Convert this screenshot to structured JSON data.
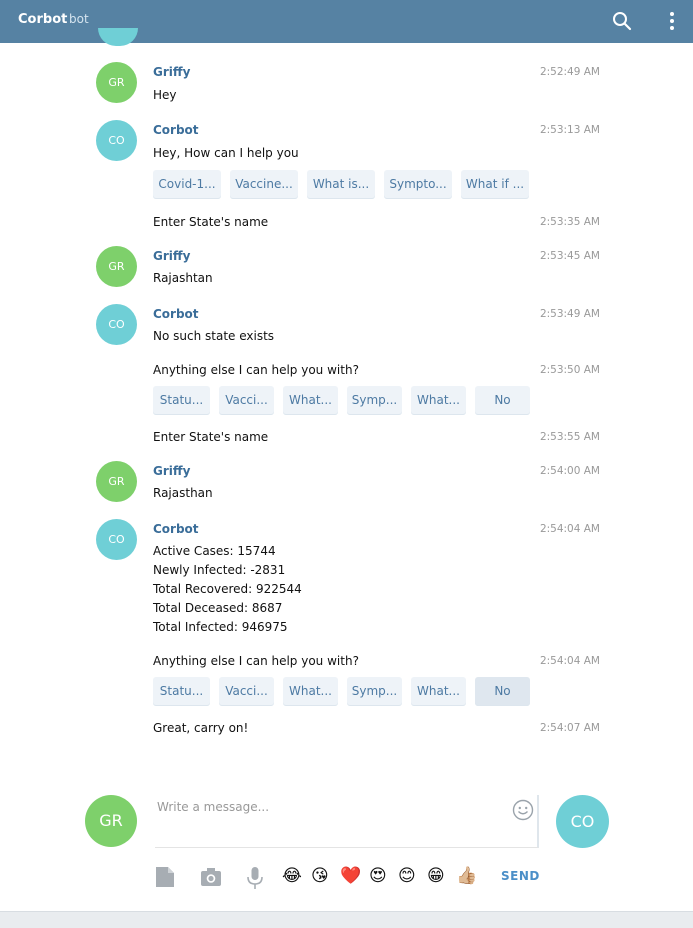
{
  "header": {
    "title": "Corbot",
    "subtitle": "bot"
  },
  "messages": {
    "m1": {
      "avatar": "GR",
      "name": "Griffy",
      "time": "2:52:49 AM",
      "text": "Hey"
    },
    "m2": {
      "avatar": "CO",
      "name": "Corbot",
      "time": "2:53:13 AM",
      "text": "Hey, How can I help you",
      "buttons": [
        "Covid-1...",
        "Vaccine...",
        "What is...",
        "Sympto...",
        "What if ..."
      ]
    },
    "m3": {
      "time": "2:53:35 AM",
      "text": "Enter State's name"
    },
    "m4": {
      "avatar": "GR",
      "name": "Griffy",
      "time": "2:53:45 AM",
      "text": "Rajashtan"
    },
    "m5": {
      "avatar": "CO",
      "name": "Corbot",
      "time": "2:53:49 AM",
      "text": "No such state exists"
    },
    "m6": {
      "time": "2:53:50 AM",
      "text": "Anything else I can help you with?",
      "buttons": [
        "Statu...",
        "Vacci...",
        "What...",
        "Symp...",
        "What...",
        "No"
      ]
    },
    "m7": {
      "time": "2:53:55 AM",
      "text": "Enter State's name"
    },
    "m8": {
      "avatar": "GR",
      "name": "Griffy",
      "time": "2:54:00 AM",
      "text": "Rajasthan"
    },
    "m9": {
      "avatar": "CO",
      "name": "Corbot",
      "time": "2:54:04 AM",
      "lines": [
        "Active Cases: 15744",
        "Newly Infected: -2831",
        "Total Recovered: 922544",
        "Total Deceased: 8687",
        "Total Infected: 946975"
      ]
    },
    "m10": {
      "time": "2:54:04 AM",
      "text": "Anything else I can help you with?",
      "buttons": [
        "Statu...",
        "Vacci...",
        "What...",
        "Symp...",
        "What...",
        "No"
      ]
    },
    "m11": {
      "time": "2:54:07 AM",
      "text": "Great, carry on!"
    }
  },
  "composer": {
    "left_avatar": "GR",
    "right_avatar": "CO",
    "placeholder": "Write a message...",
    "send_label": "SEND",
    "emojis": [
      "😂",
      "😘",
      "❤️",
      "😍",
      "😊",
      "😁",
      "👍🏼"
    ]
  },
  "colors": {
    "header": "#5682a3",
    "name": "#3a6d99",
    "button_bg": "#eef3f8",
    "button_text": "#4d7aa3",
    "send": "#4b8fc8",
    "avatar_gr": "#7ed06b",
    "avatar_co": "#6fcfd6"
  }
}
